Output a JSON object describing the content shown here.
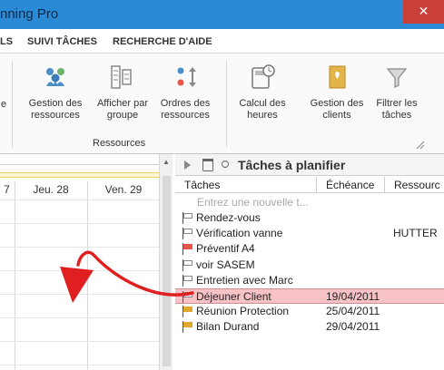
{
  "window": {
    "title": "nning Pro",
    "close_glyph": "✕"
  },
  "menu": {
    "tabs": [
      {
        "label": "LS"
      },
      {
        "label": "SUIVI TÂCHES"
      },
      {
        "label": "RECHERCHE D'AIDE"
      }
    ]
  },
  "ribbon": {
    "buttons": [
      {
        "label": "e",
        "icon": "partial-icon"
      },
      {
        "label": "Gestion des ressources",
        "icon": "people-icon"
      },
      {
        "label": "Afficher par groupe",
        "icon": "group-list-icon"
      },
      {
        "label": "Ordres des ressources",
        "icon": "sort-people-icon"
      },
      {
        "label": "Calcul des heures",
        "icon": "calculator-clock-icon"
      },
      {
        "label": "Gestion des clients",
        "icon": "client-book-icon"
      },
      {
        "label": "Filtrer les tâches",
        "icon": "filter-funnel-icon"
      }
    ],
    "group_label": "Ressources"
  },
  "calendar": {
    "days": [
      "7",
      "Jeu. 28",
      "Ven. 29"
    ]
  },
  "tasks_panel": {
    "title": "Tâches à planifier",
    "columns": {
      "name": "Tâches",
      "date": "Échéance",
      "resource": "Ressourc"
    },
    "new_placeholder": "Entrez une nouvelle t...",
    "rows": [
      {
        "name": "Rendez-vous",
        "date": "",
        "resource": "",
        "flag_color": "#ffffff",
        "selected": false
      },
      {
        "name": "Vérification vanne",
        "date": "",
        "resource": "HUTTER",
        "flag_color": "#ffffff",
        "selected": false
      },
      {
        "name": "Préventif A4",
        "date": "",
        "resource": "",
        "flag_color": "#e8554a",
        "selected": false
      },
      {
        "name": "voir SASEM",
        "date": "",
        "resource": "",
        "flag_color": "#ffffff",
        "selected": false
      },
      {
        "name": "Entretien avec Marc",
        "date": "",
        "resource": "",
        "flag_color": "#ffffff",
        "selected": false
      },
      {
        "name": "Déjeuner Client",
        "date": "19/04/2011",
        "resource": "",
        "flag_color": "#ffffff",
        "selected": true
      },
      {
        "name": "Réunion Protection",
        "date": "25/04/2011",
        "resource": "",
        "flag_color": "#e0a82a",
        "selected": false
      },
      {
        "name": "Bilan Durand",
        "date": "29/04/2011",
        "resource": "",
        "flag_color": "#e0a82a",
        "selected": false
      }
    ]
  },
  "colors": {
    "titlebar": "#2b8ad6",
    "close": "#c9403a",
    "selection": "#f6c2c6",
    "arrow": "#e02020"
  }
}
